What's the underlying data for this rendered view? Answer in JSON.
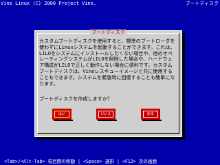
{
  "header": {
    "left_text": "Vine Linux (C) 2000 Project Vine.",
    "right_text": "ブートディスク"
  },
  "dialog": {
    "title": "ブートディスク",
    "body": "カスタムブートディスクを使用すると、標準のブートローダを使わずにLinuxシステムを起動することができます。これは、LILOをシステムにインストールしたくない場合や、他のオペレーティングシステムがLILOを削除した場合や、ハードウェア構成がLILOで正しく動作しない場合に便利です。カスタムブートディスクは、Vineレスキューイメージと共に使用することもできます。システムを緊急時に回復することも簡単になります。",
    "question": "ブートディスクを作成しますか？",
    "buttons": [
      {
        "label": "はい"
      },
      {
        "label": "いいえ"
      },
      {
        "label": "戻る"
      }
    ]
  },
  "footer": {
    "hint": "<Tab>/<Alt-Tab> 項目間の移動 | <Space> 選択 | <F12> 次の画面"
  },
  "colors": {
    "background": "#0000aa",
    "dialog": "#cfcfcf",
    "accent": "#cc0000",
    "text": "#000000"
  }
}
